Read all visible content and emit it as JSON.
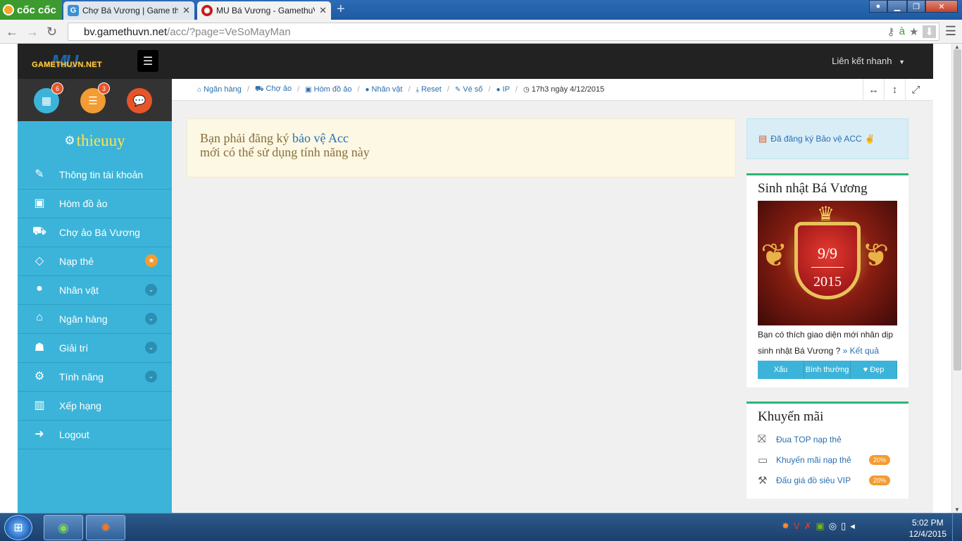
{
  "browser": {
    "brand": "cốc cốc",
    "tabs": [
      {
        "title": "Chợ Bá Vương | Game thủ",
        "favicon": "G",
        "active": false
      },
      {
        "title": "MU Bá Vương - GamethuV",
        "favicon": "",
        "active": true
      }
    ],
    "url_host": "bv.gamethuvn.net",
    "url_path": "/acc/?page=VeSoMayMan"
  },
  "site": {
    "logo_text": "GAMETHUVN.NET",
    "logo_mark": "MU",
    "quick_links": "Liên kết nhanh",
    "username": "thieuuy",
    "top_icons": [
      {
        "icon": "calendar-icon",
        "color": "#3cb4d9",
        "badge": "6"
      },
      {
        "icon": "list-icon",
        "color": "#f39c32",
        "badge": "3"
      },
      {
        "icon": "chat-icon",
        "color": "#e8542a",
        "badge": ""
      }
    ],
    "sidebar": [
      {
        "label": "Thông tin tài khoản",
        "icon": "edit-icon",
        "glyph": "✎",
        "extra": ""
      },
      {
        "label": "Hòm đồ ảo",
        "icon": "briefcase-icon",
        "glyph": "▣",
        "extra": ""
      },
      {
        "label": "Chợ ảo Bá Vương",
        "icon": "cart-icon",
        "glyph": "⛟",
        "extra": ""
      },
      {
        "label": "Nạp thẻ",
        "icon": "diamond-icon",
        "glyph": "◇",
        "extra": "star"
      },
      {
        "label": "Nhân vật",
        "icon": "user-icon",
        "glyph": "●",
        "extra": "chevron"
      },
      {
        "label": "Ngân hàng",
        "icon": "bank-icon",
        "glyph": "⌂",
        "extra": "chevron"
      },
      {
        "label": "Giải trí",
        "icon": "android-icon",
        "glyph": "☗",
        "extra": "chevron"
      },
      {
        "label": "Tính năng",
        "icon": "cogs-icon",
        "glyph": "⚙",
        "extra": "chevron"
      },
      {
        "label": "Xếp hạng",
        "icon": "bar-chart-icon",
        "glyph": "▥",
        "extra": ""
      },
      {
        "label": "Logout",
        "icon": "logout-icon",
        "glyph": "➜",
        "extra": ""
      }
    ],
    "breadcrumb": [
      "Ngân hàng",
      "Chợ ảo",
      "Hòm đồ ảo",
      "Nhân vật",
      "Reset",
      "Vé số",
      "IP"
    ],
    "time": "17h3 ngày 4/12/2015",
    "warning_line1": "Bạn phải đăng ký",
    "warning_link": "bảo vệ Acc",
    "warning_line2": "mới có thể sử dụng tính năng này",
    "protect_status": "Đã đăng ký Bảo vệ ACC",
    "birthday": {
      "title": "Sinh nhật Bá Vương",
      "date": "9/9",
      "year": "2015",
      "question": "Bạn có thích giao diện mới nhân dịp sinh nhật Bá Vương ?",
      "result_link": "» Kết quả",
      "votes": [
        "Xấu",
        "Bình thường",
        "♥ Đẹp"
      ]
    },
    "promo": {
      "title": "Khuyến mãi",
      "items": [
        {
          "label": "Đua TOP nạp thẻ",
          "icon": "gift-icon",
          "pct": ""
        },
        {
          "label": "Khuyến mãi nạp thẻ",
          "icon": "money-icon",
          "pct": "20%"
        },
        {
          "label": "Đấu giá đồ siêu VIP",
          "icon": "gavel-icon",
          "pct": "20%"
        }
      ]
    }
  },
  "taskbar": {
    "time": "5:02 PM",
    "date": "12/4/2015"
  }
}
